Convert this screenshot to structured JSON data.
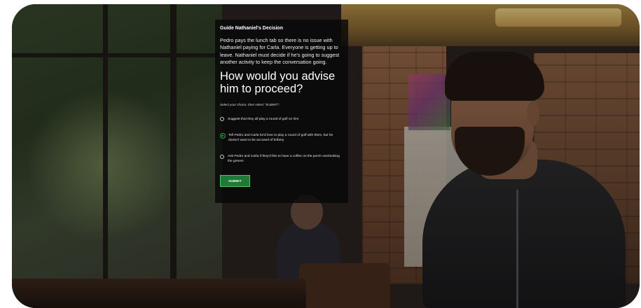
{
  "panel": {
    "title": "Guide Nathaniel's Decision",
    "body": "Pedro pays the lunch tab so there is no issue with Nathaniel paying for Carla. Everyone is getting up to leave. Nathaniel must decide if he's going to suggest another activity to keep the conversation going.",
    "question": "How would you advise him to proceed?",
    "instruction": "Select your choice, then select \"SUBMIT\".",
    "options": [
      {
        "label": "Suggest that they all play a round of golf on him",
        "selected": false
      },
      {
        "label": "Tell Pedro and Carla he'd love to play a round of golf with them, but he doesn't want to be accused of bribery",
        "selected": true
      },
      {
        "label": "Ask Pedro and Carla if they'd like to have a coffee on the porch overlooking the greens",
        "selected": false
      }
    ],
    "submit_label": "SUBMIT"
  },
  "colors": {
    "panel_background": "#080808",
    "selected_radio": "#2ea84a",
    "submit_button": "#1f7a35"
  }
}
